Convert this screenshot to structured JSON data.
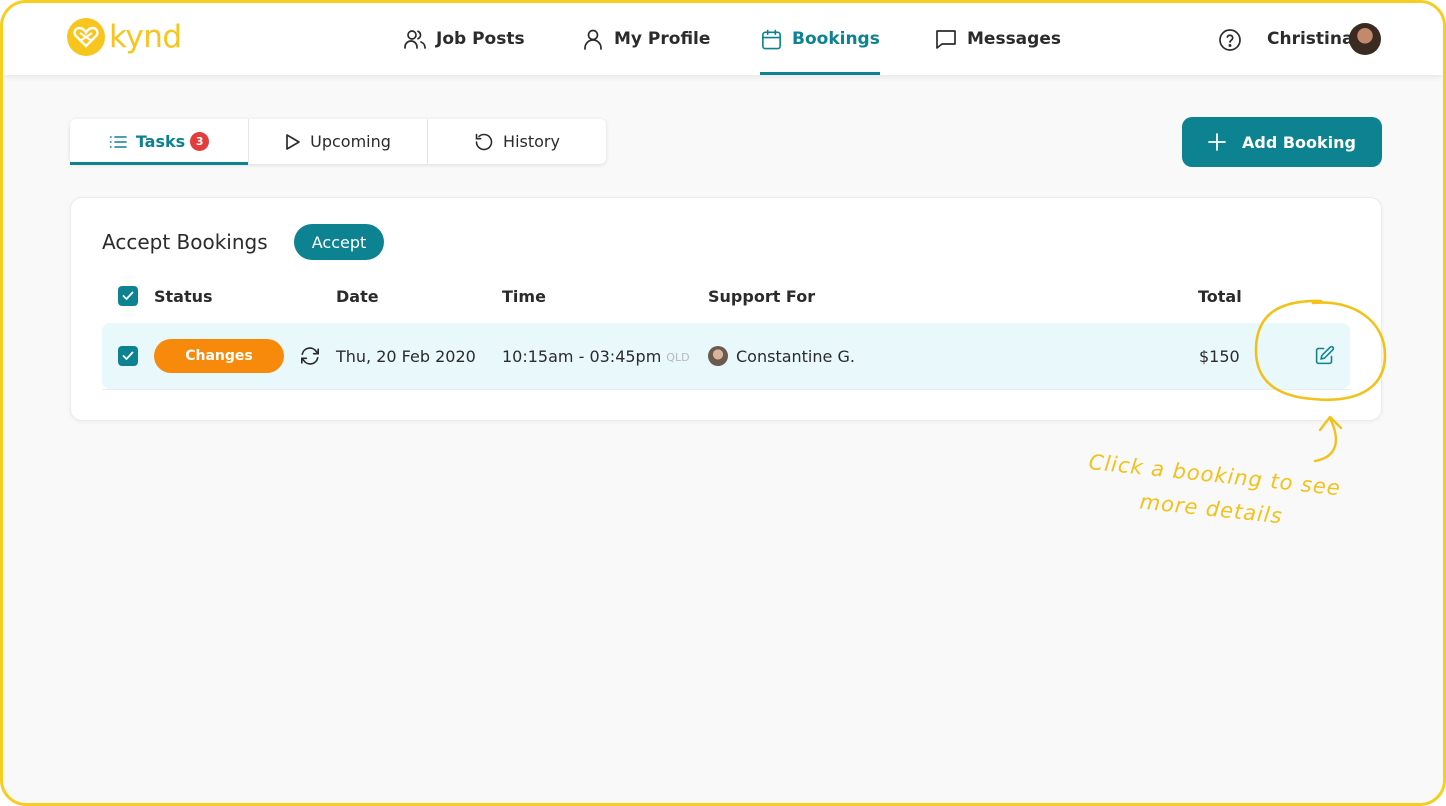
{
  "app": {
    "logo_text": "kynd",
    "brand_color": "#f7c51b",
    "accent_color": "#0d8290"
  },
  "nav": {
    "items": [
      {
        "label": "Job Posts",
        "icon": "users-icon"
      },
      {
        "label": "My Profile",
        "icon": "user-icon"
      },
      {
        "label": "Bookings",
        "icon": "calendar-icon",
        "active": true
      },
      {
        "label": "Messages",
        "icon": "chat-icon"
      }
    ],
    "user_name": "Christina"
  },
  "tabs": [
    {
      "label": "Tasks",
      "icon": "list-icon",
      "badge": "3",
      "active": true
    },
    {
      "label": "Upcoming",
      "icon": "play-icon"
    },
    {
      "label": "History",
      "icon": "history-icon"
    }
  ],
  "add_booking_label": "Add Booking",
  "card": {
    "title": "Accept Bookings",
    "accept_label": "Accept",
    "columns": [
      "Status",
      "Date",
      "Time",
      "Support For",
      "Total"
    ],
    "rows": [
      {
        "checked": true,
        "status": "Changes",
        "status_color": "#f78a0a",
        "date": "Thu, 20 Feb 2020",
        "time": "10:15am - 03:45pm",
        "timezone": "QLD",
        "support_for": "Constantine G.",
        "total": "$150"
      }
    ]
  },
  "annotation": {
    "line1": "Click a booking to see",
    "line2": "more details",
    "color": "#f2c21a"
  }
}
